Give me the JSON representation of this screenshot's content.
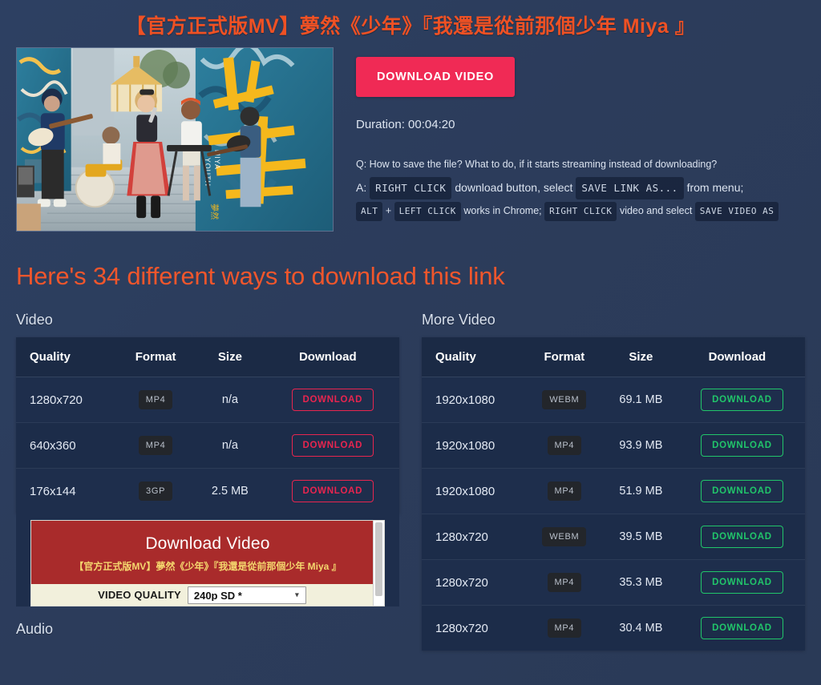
{
  "page": {
    "title": "【官方正式版MV】夢然《少年》『我還是從前那個少年 Miya 』",
    "ways_heading": "Here's 34 different ways to download this link",
    "accent_orange": "#ef5124",
    "background": "#2c3c5b",
    "red_accent": "#e8254f",
    "green_accent": "#21c56a"
  },
  "hero": {
    "thumbnail_alt": "music-video-thumbnail",
    "download_button": "DOWNLOAD VIDEO",
    "duration_label": "Duration: 00:04:20",
    "faq": {
      "question": "Q: How to save the file? What to do, if it starts streaming instead of downloading?",
      "answer_prefix": "A:",
      "key_right_click": "RIGHT CLICK",
      "answer_mid1": "download button, select",
      "key_save_link_as": "SAVE LINK AS...",
      "answer_mid2": "from menu;",
      "key_alt": "ALT",
      "plus": "+",
      "key_left_click": "LEFT CLICK",
      "answer_mid3": "works in Chrome;",
      "key_right_click2": "RIGHT CLICK",
      "answer_mid4": "video and select",
      "key_save_video_as": "SAVE VIDEO AS"
    }
  },
  "columns": {
    "left": {
      "label": "Video",
      "headers": [
        "Quality",
        "Format",
        "Size",
        "Download"
      ],
      "rows": [
        {
          "quality": "1280x720",
          "format": "MP4",
          "size": "n/a",
          "download": "DOWNLOAD"
        },
        {
          "quality": "640x360",
          "format": "MP4",
          "size": "n/a",
          "download": "DOWNLOAD"
        },
        {
          "quality": "176x144",
          "format": "3GP",
          "size": "2.5 MB",
          "download": "DOWNLOAD"
        }
      ],
      "embed": {
        "title": "Download Video",
        "subtitle": "【官方正式版MV】夢然《少年》『我還是從前那個少年 Miya 』",
        "quality_label": "VIDEO QUALITY",
        "selected_option": "240p SD *"
      },
      "audio_label": "Audio"
    },
    "right": {
      "label": "More Video",
      "headers": [
        "Quality",
        "Format",
        "Size",
        "Download"
      ],
      "rows": [
        {
          "quality": "1920x1080",
          "format": "WEBM",
          "size": "69.1 MB",
          "download": "DOWNLOAD"
        },
        {
          "quality": "1920x1080",
          "format": "MP4",
          "size": "93.9 MB",
          "download": "DOWNLOAD"
        },
        {
          "quality": "1920x1080",
          "format": "MP4",
          "size": "51.9 MB",
          "download": "DOWNLOAD"
        },
        {
          "quality": "1280x720",
          "format": "WEBM",
          "size": "39.5 MB",
          "download": "DOWNLOAD"
        },
        {
          "quality": "1280x720",
          "format": "MP4",
          "size": "35.3 MB",
          "download": "DOWNLOAD"
        },
        {
          "quality": "1280x720",
          "format": "MP4",
          "size": "30.4 MB",
          "download": "DOWNLOAD"
        }
      ]
    }
  }
}
